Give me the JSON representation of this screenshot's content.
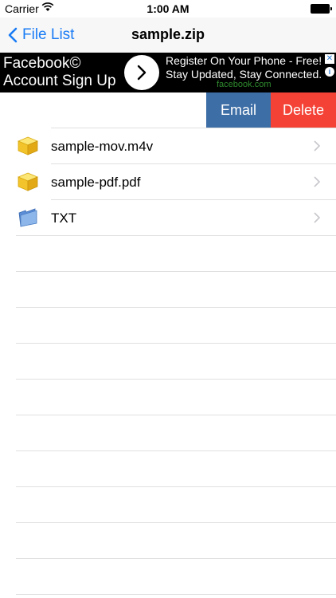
{
  "status_bar": {
    "carrier": "Carrier",
    "time": "1:00 AM"
  },
  "nav": {
    "back_label": "File List",
    "title": "sample.zip"
  },
  "ad": {
    "left_line1": "Facebook©",
    "left_line2": "Account Sign Up",
    "right_line1": "Register On Your Phone - Free!",
    "right_line2": "Stay Updated, Stay Connected.",
    "domain": "facebook.com",
    "close_glyph": "✕",
    "info_glyph": "i"
  },
  "actions": {
    "email_label": "Email",
    "delete_label": "Delete"
  },
  "files": [
    {
      "name": "sample-mov.m4v",
      "icon": "package-icon"
    },
    {
      "name": "sample-pdf.pdf",
      "icon": "package-icon"
    },
    {
      "name": "TXT",
      "icon": "folder-icon"
    }
  ],
  "colors": {
    "accent": "#1a7cf5",
    "email_button": "#3e6ea6",
    "delete_button": "#f44336",
    "ad_background": "#000000"
  }
}
